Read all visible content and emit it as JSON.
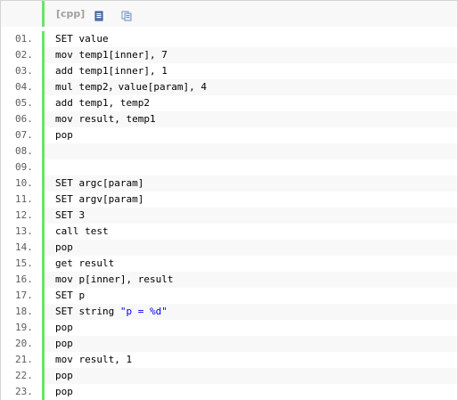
{
  "toolbar": {
    "language_label": "[cpp]",
    "icons": [
      "view-source-icon",
      "copy-icon"
    ]
  },
  "lines": [
    {
      "num": "01.",
      "code": "SET value"
    },
    {
      "num": "02.",
      "code": "mov temp1[inner], 7"
    },
    {
      "num": "03.",
      "code": "add temp1[inner], 1"
    },
    {
      "num": "04.",
      "code": "mul temp2，value[param], 4"
    },
    {
      "num": "05.",
      "code": "add temp1, temp2"
    },
    {
      "num": "06.",
      "code": "mov result, temp1"
    },
    {
      "num": "07.",
      "code": "pop"
    },
    {
      "num": "08.",
      "code": ""
    },
    {
      "num": "09.",
      "code": ""
    },
    {
      "num": "10.",
      "code": "SET argc[param]"
    },
    {
      "num": "11.",
      "code": "SET argv[param]"
    },
    {
      "num": "12.",
      "code": "SET 3"
    },
    {
      "num": "13.",
      "code": "call test"
    },
    {
      "num": "14.",
      "code": "pop"
    },
    {
      "num": "15.",
      "code": "get result"
    },
    {
      "num": "16.",
      "code": "mov p[inner], result"
    },
    {
      "num": "17.",
      "code": "SET p"
    },
    {
      "num": "18.",
      "code_prefix": "SET string ",
      "code_string": "\"p = %d\""
    },
    {
      "num": "19.",
      "code": "pop"
    },
    {
      "num": "20.",
      "code": "pop"
    },
    {
      "num": "21.",
      "code": "mov result, 1"
    },
    {
      "num": "22.",
      "code": "pop"
    },
    {
      "num": "23.",
      "code": "pop"
    }
  ],
  "colors": {
    "gutter_bar": "#6ce26c",
    "alt_row": "#f8f8f8",
    "string": "#0000ff"
  }
}
